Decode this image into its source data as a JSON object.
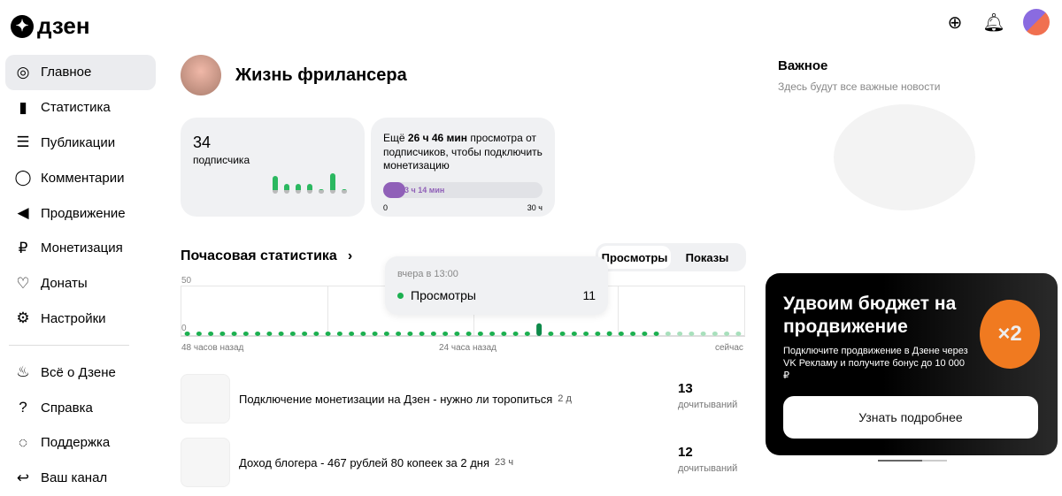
{
  "header": {
    "logo": "дзен",
    "logo_mark": "✦"
  },
  "sidebar": {
    "items": [
      {
        "label": "Главное",
        "icon": "planet-icon",
        "glyph": "◎"
      },
      {
        "label": "Статистика",
        "icon": "bar-chart-icon",
        "glyph": "▮"
      },
      {
        "label": "Публикации",
        "icon": "stack-icon",
        "glyph": "☰"
      },
      {
        "label": "Комментарии",
        "icon": "comment-icon",
        "glyph": "◯"
      },
      {
        "label": "Продвижение",
        "icon": "megaphone-icon",
        "glyph": "◀"
      },
      {
        "label": "Монетизация",
        "icon": "ruble-icon",
        "glyph": "₽"
      },
      {
        "label": "Донаты",
        "icon": "donate-icon",
        "glyph": "♡"
      },
      {
        "label": "Настройки",
        "icon": "gear-icon",
        "glyph": "⚙"
      }
    ],
    "bottom": [
      {
        "label": "Всё о Дзене",
        "icon": "flame-icon",
        "glyph": "♨"
      },
      {
        "label": "Справка",
        "icon": "help-icon",
        "glyph": "?"
      },
      {
        "label": "Поддержка",
        "icon": "support-icon",
        "glyph": "◌"
      },
      {
        "label": "Ваш канал",
        "icon": "back-arrow-icon",
        "glyph": "↩"
      }
    ]
  },
  "channel": {
    "name": "Жизнь фрилансера"
  },
  "subscribers": {
    "count": "34",
    "label": "подписчика",
    "bars": [
      6,
      3,
      3,
      3,
      1,
      7,
      1
    ]
  },
  "monetization": {
    "prefix": "Ещё ",
    "bold": "26 ч 46 мин",
    "suffix": " просмотра от подписчиков, чтобы подключить монетизацию",
    "progress_label": "3 ч 14 мин",
    "progress_fraction": 0.108,
    "min": "0",
    "max": "30 ч"
  },
  "hourly": {
    "title": "Почасовая статистика",
    "tabs": [
      "Просмотры",
      "Показы"
    ],
    "active_tab": 0,
    "tooltip": {
      "time": "вчера в 13:00",
      "series": "Просмотры",
      "value": "11"
    }
  },
  "chart_data": {
    "type": "bar",
    "ylim": [
      0,
      50
    ],
    "yticks": [
      "50",
      "0"
    ],
    "xlabels": [
      "48 часов назад",
      "24 часа назад",
      "сейчас"
    ],
    "values": [
      0,
      2,
      1,
      1,
      1,
      1,
      1,
      1,
      1,
      1,
      1,
      1,
      1,
      1,
      2,
      1,
      1,
      1,
      2,
      1,
      1,
      1,
      1,
      1,
      1,
      1,
      1,
      1,
      1,
      1,
      11,
      2,
      1,
      1,
      1,
      1,
      3,
      1,
      1,
      1,
      2,
      1,
      1,
      1,
      1,
      1,
      1,
      1
    ],
    "current_from_index": 41
  },
  "publications": [
    {
      "title": "Подключение монетизации на Дзен - нужно ли торопиться",
      "age": "2 д",
      "reads": "13",
      "reads_label": "дочитываний"
    },
    {
      "title": "Доход блогера - 467 рублей 80 копеек за 2 дня",
      "age": "23 ч",
      "reads": "12",
      "reads_label": "дочитываний"
    }
  ],
  "important": {
    "title": "Важное",
    "subtitle": "Здесь будут все важные новости"
  },
  "promo": {
    "title": "Удвоим бюджет на продвижение",
    "text": "Подключите продвижение в Дзене через VK Рекламу и получите бонус до 10 000 ₽",
    "button": "Узнать подробнее",
    "coin": "×2"
  }
}
